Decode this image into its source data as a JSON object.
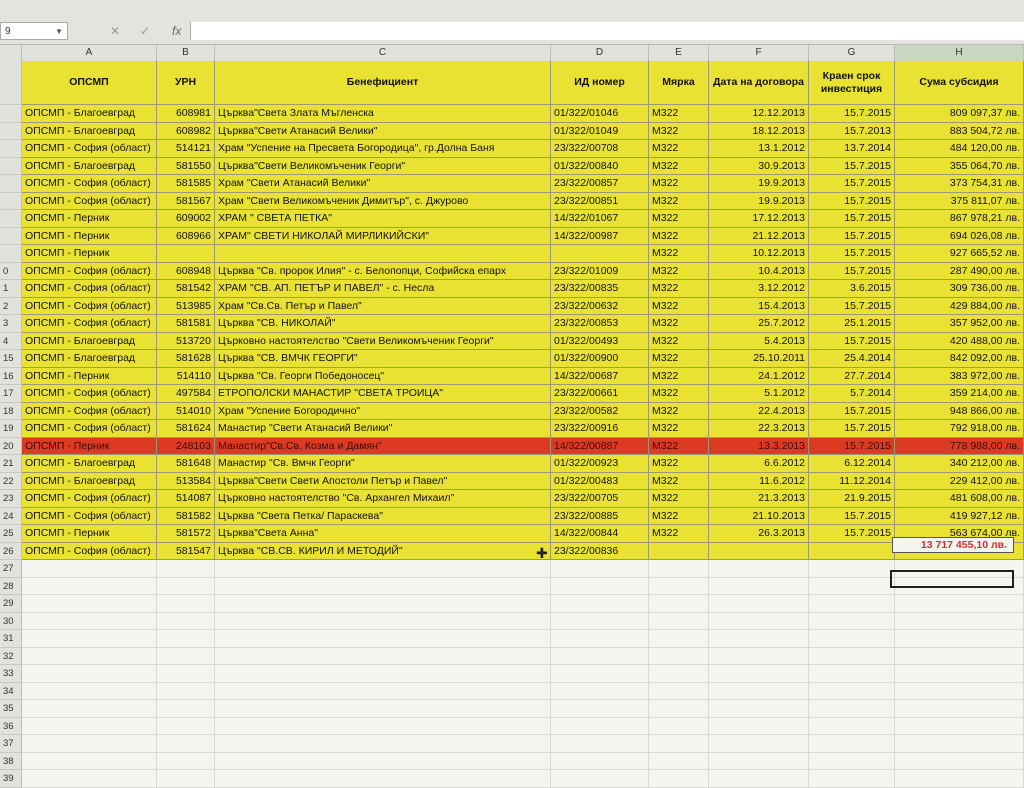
{
  "formula_bar": {
    "name_box": "9",
    "fx": "fx",
    "cancel": "✕",
    "enter": "✓"
  },
  "columns": [
    "A",
    "B",
    "C",
    "D",
    "E",
    "F",
    "G",
    "H"
  ],
  "header": {
    "a": "ОПСМП",
    "b": "УРН",
    "c": "Бенефициент",
    "d": "ИД номер",
    "e": "Мярка",
    "f": "Дата на договора",
    "g": "Краен срок инвестиция",
    "h": "Сума субсидия"
  },
  "rows": [
    {
      "n": "",
      "a": "ОПСМП - Благоевград",
      "b": "608981",
      "c": "Църква\"Света Злата Мъгленска",
      "d": "01/322/01046",
      "e": "М322",
      "f": "12.12.2013",
      "g": "15.7.2015",
      "h": "809 097,37 лв."
    },
    {
      "n": "",
      "a": "ОПСМП - Благоевград",
      "b": "608982",
      "c": "Църква\"Свети Атанасий Велики\"",
      "d": "01/322/01049",
      "e": "М322",
      "f": "18.12.2013",
      "g": "15.7.2013",
      "h": "883 504,72 лв."
    },
    {
      "n": "",
      "a": "ОПСМП - София (област)",
      "b": "514121",
      "c": "Храм \"Успение на Пресвета Богородица\", гр.Долна Баня",
      "d": "23/322/00708",
      "e": "М322",
      "f": "13.1.2012",
      "g": "13.7.2014",
      "h": "484 120,00 лв."
    },
    {
      "n": "",
      "a": "ОПСМП - Благоевград",
      "b": "581550",
      "c": "Църква\"Свети Великомъченик Георги\"",
      "d": "01/322/00840",
      "e": "М322",
      "f": "30.9.2013",
      "g": "15.7.2015",
      "h": "355 064,70 лв."
    },
    {
      "n": "",
      "a": "ОПСМП - София (област)",
      "b": "581585",
      "c": "Храм \"Свети Атанасий Велики\"",
      "d": "23/322/00857",
      "e": "М322",
      "f": "19.9.2013",
      "g": "15.7.2015",
      "h": "373 754,31 лв."
    },
    {
      "n": "",
      "a": "ОПСМП - София (област)",
      "b": "581567",
      "c": "Храм \"Свети Великомъченик Димитър\", с. Джурово",
      "d": "23/322/00851",
      "e": "М322",
      "f": "19.9.2013",
      "g": "15.7.2015",
      "h": "375 811,07 лв."
    },
    {
      "n": "",
      "a": "ОПСМП - Перник",
      "b": "609002",
      "c": "ХРАМ \" СВЕТА ПЕТКА\"",
      "d": "14/322/01067",
      "e": "М322",
      "f": "17.12.2013",
      "g": "15.7.2015",
      "h": "867 978,21 лв."
    },
    {
      "n": "",
      "a": "ОПСМП - Перник",
      "b": "608966",
      "c": "ХРАМ\" СВЕТИ НИКОЛАЙ МИРЛИКИЙСКИ\"",
      "d": "14/322/00987",
      "e": "М322",
      "f": "21.12.2013",
      "g": "15.7.2015",
      "h": "694 026,08 лв."
    },
    {
      "n": "",
      "a": "ОПСМП - Перник",
      "b": "",
      "c": "",
      "d": "",
      "e": "М322",
      "f": "10.12.2013",
      "g": "15.7.2015",
      "h": "927 665,52 лв."
    },
    {
      "n": "0",
      "a": "ОПСМП - София (област)",
      "b": "608948",
      "c": "Църква \"Св. пророк Илия\" - с. Белопопци, Софийска епарх",
      "d": "23/322/01009",
      "e": "М322",
      "f": "10.4.2013",
      "g": "15.7.2015",
      "h": "287 490,00 лв."
    },
    {
      "n": "1",
      "a": "ОПСМП - София (област)",
      "b": "581542",
      "c": "ХРАМ \"СВ. АП. ПЕТЪР И ПАВЕЛ\" - с. Несла",
      "d": "23/322/00835",
      "e": "М322",
      "f": "3.12.2012",
      "g": "3.6.2015",
      "h": "309 736,00 лв."
    },
    {
      "n": "2",
      "a": "ОПСМП - София (област)",
      "b": "513985",
      "c": "Храм \"Св.Св. Петър и Павел\"",
      "d": "23/322/00632",
      "e": "М322",
      "f": "15.4.2013",
      "g": "15.7.2015",
      "h": "429 884,00 лв."
    },
    {
      "n": "3",
      "a": "ОПСМП - София (област)",
      "b": "581581",
      "c": "Църква \"СВ. НИКОЛАЙ\"",
      "d": "23/322/00853",
      "e": "М322",
      "f": "25.7.2012",
      "g": "25.1.2015",
      "h": "357 952,00 лв."
    },
    {
      "n": "4",
      "a": "ОПСМП - Благоевград",
      "b": "513720",
      "c": "Църковно настоятелство \"Свети Великомъченик Георги\"",
      "d": "01/322/00493",
      "e": "М322",
      "f": "5.4.2013",
      "g": "15.7.2015",
      "h": "420 488,00 лв."
    },
    {
      "n": "15",
      "a": "ОПСМП - Благоевград",
      "b": "581628",
      "c": "Църква \"СВ. ВМЧК ГЕОРГИ\"",
      "d": "01/322/00900",
      "e": "М322",
      "f": "25.10.2011",
      "g": "25.4.2014",
      "h": "842 092,00 лв."
    },
    {
      "n": "16",
      "a": "ОПСМП - Перник",
      "b": "514110",
      "c": "Църква \"Св. Георги Победоносец\"",
      "d": "14/322/00687",
      "e": "М322",
      "f": "24.1.2012",
      "g": "27.7.2014",
      "h": "383 972,00 лв."
    },
    {
      "n": "17",
      "a": "ОПСМП - София (област)",
      "b": "497584",
      "c": "ЕТРОПОЛСКИ МАНАСТИР \"СВЕТА ТРОИЦА\"",
      "d": "23/322/00661",
      "e": "М322",
      "f": "5.1.2012",
      "g": "5.7.2014",
      "h": "359 214,00 лв."
    },
    {
      "n": "18",
      "a": "ОПСМП - София (област)",
      "b": "514010",
      "c": "Храм \"Успение Богородично\"",
      "d": "23/322/00582",
      "e": "М322",
      "f": "22.4.2013",
      "g": "15.7.2015",
      "h": "948 866,00 лв."
    },
    {
      "n": "19",
      "a": "ОПСМП - София (област)",
      "b": "581624",
      "c": "Манастир \"Свети Атанасий Велики\"",
      "d": "23/322/00916",
      "e": "М322",
      "f": "22.3.2013",
      "g": "15.7.2015",
      "h": "792 918,00 лв."
    },
    {
      "n": "20",
      "a": "ОПСМП - Перник",
      "b": "248103",
      "c": "Манастир\"Св.Св. Козма и Дамян\"",
      "d": "14/322/00887",
      "e": "М322",
      "f": "13.3.2013",
      "g": "15.7.2015",
      "h": "778 988,00 лв."
    },
    {
      "n": "21",
      "a": "ОПСМП - Благоевград",
      "b": "581648",
      "c": "Манастир \"Св. Вмчк Георги\"",
      "d": "01/322/00923",
      "e": "М322",
      "f": "6.6.2012",
      "g": "6.12.2014",
      "h": "340 212,00 лв."
    },
    {
      "n": "22",
      "a": "ОПСМП - Благоевград",
      "b": "513584",
      "c": "Църква\"Свети Свети Апостоли Петър и Павел\"",
      "d": "01/322/00483",
      "e": "М322",
      "f": "11.6.2012",
      "g": "11.12.2014",
      "h": "229 412,00 лв."
    },
    {
      "n": "23",
      "a": "ОПСМП - София (област)",
      "b": "514087",
      "c": "Църковно настоятелство \"Св. Архангел Михаил\"",
      "d": "23/322/00705",
      "e": "М322",
      "f": "21.3.2013",
      "g": "21.9.2015",
      "h": "481 608,00 лв."
    },
    {
      "n": "24",
      "a": "ОПСМП - София (област)",
      "b": "581582",
      "c": "Църква \"Света Петка/ Параскева\"",
      "d": "23/322/00885",
      "e": "М322",
      "f": "21.10.2013",
      "g": "15.7.2015",
      "h": "419 927,12 лв."
    },
    {
      "n": "25",
      "a": "ОПСМП - Перник",
      "b": "581572",
      "c": "Църква\"Света Анна\"",
      "d": "14/322/00844",
      "e": "М322",
      "f": "26.3.2013",
      "g": "15.7.2015",
      "h": "563 674,00 лв."
    },
    {
      "n": "26",
      "a": "ОПСМП - София (област)",
      "b": "581547",
      "c": "Църква \"СВ.СВ. КИРИЛ И МЕТОДИЙ\"",
      "d": "23/322/00836",
      "e": "",
      "f": "",
      "g": "",
      "h": ""
    }
  ],
  "highlight_row_index": 19,
  "total": "13 717 455,10 лв.",
  "empty_row_numbers": [
    "27",
    "28",
    "29",
    "30",
    "31",
    "32",
    "33",
    "34",
    "35",
    "36",
    "37",
    "38",
    "39"
  ]
}
